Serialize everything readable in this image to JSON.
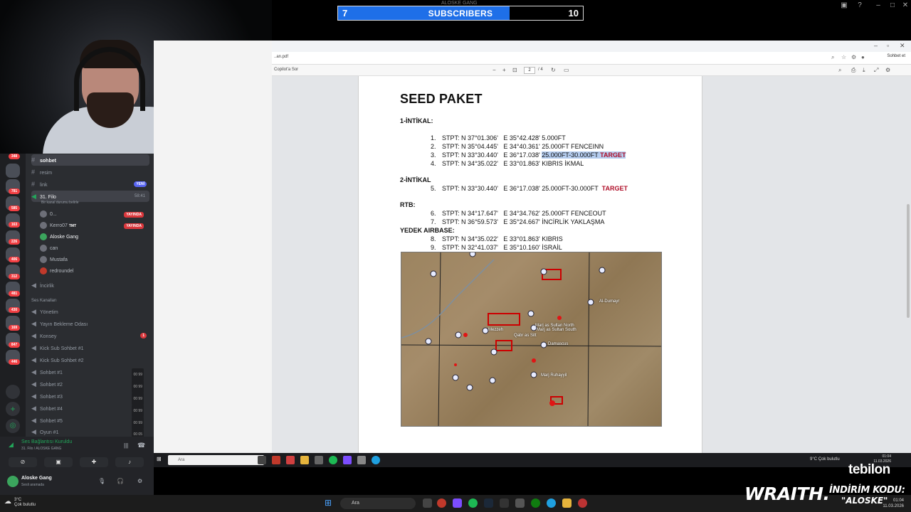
{
  "overlay": {
    "channel_label": "ALOSKE GANG",
    "subscribers": {
      "current": "7",
      "label": "SUBSCRIBERS",
      "goal": "10",
      "progress_fraction": 0.7
    }
  },
  "browser": {
    "url": "..an.pdf",
    "copilot_label": "Copilot'a Sor",
    "chat_label": "Sohbet et",
    "page_current": "2",
    "page_total": "/ 4"
  },
  "pdf": {
    "title": "SEED PAKET",
    "sections": [
      {
        "label": "1-İNTİKAL:",
        "items": [
          {
            "n": "1.",
            "text": "STPT: N 37°01.306'   E 35°42.428' 5.000FT",
            "hl": "",
            "target": ""
          },
          {
            "n": "2.",
            "text": "STPT: N 35°04.445'   E 34°40.361' 25.000FT FENCEINN",
            "hl": "",
            "target": ""
          },
          {
            "n": "3.",
            "text": "STPT: N 33°30.440'   E 36°17.038' ",
            "hl": "25.000FT-30.000FT",
            "target": "TARGET"
          },
          {
            "n": "4.",
            "text": "STPT: N 34°35.022'   E 33°01.863' KIBRIS İKMAL",
            "hl": "",
            "target": ""
          }
        ]
      },
      {
        "label": "2-İNTİKAL",
        "items": [
          {
            "n": "5.",
            "text": "STPT: N 33°30.440'   E 36°17.038' 25.000FT-30.000FT  ",
            "hl": "",
            "target": "TARGET"
          }
        ]
      },
      {
        "label": "RTB:",
        "items": [
          {
            "n": "6.",
            "text": "STPT: N 34°17.647'   E 34°34.762' 25.000FT FENCEOUT",
            "hl": "",
            "target": ""
          },
          {
            "n": "7.",
            "text": "STPT: N 36°59.573'   E 35°24.667' İNCİRLİK YAKLAŞMA",
            "hl": "",
            "target": ""
          }
        ]
      },
      {
        "label": "YEDEK AIRBASE:",
        "items": [
          {
            "n": "8.",
            "text": "STPT: N 34°35.022'   E 33°01.863' KIBRIS",
            "hl": "",
            "target": ""
          },
          {
            "n": "9.",
            "text": "STPT: N 32°41.037'   E 35°10.160' İSRAİL",
            "hl": "",
            "target": ""
          }
        ]
      }
    ],
    "map_labels": [
      "Al-Dumayr",
      "Marj as Sultan North",
      "Marj as Sultan South",
      "Qabr as Sitt",
      "Mezzeh",
      "Damascus",
      "Marj Ruhayyil"
    ]
  },
  "discord": {
    "server_badges": [
      "348",
      "781",
      "585",
      "163",
      "226",
      "406",
      "312",
      "481",
      "430",
      "169",
      "847",
      "446"
    ],
    "channels": [
      {
        "name": "sohbet",
        "badge": ""
      },
      {
        "name": "resim",
        "badge": ""
      },
      {
        "name": "link",
        "badge": "YENİ"
      }
    ],
    "voice_channel": {
      "name": "31. Filo",
      "timer": "58:41",
      "status": "Bir kanal durumu belirle"
    },
    "voice_users": [
      {
        "name": "0...",
        "live": "YAYINDA"
      },
      {
        "name": "Kerro07",
        "tag": "TMT",
        "live": "YAYINDA"
      },
      {
        "name": "Aloske Gang",
        "live": ""
      },
      {
        "name": "can",
        "live": ""
      },
      {
        "name": "Mustafa",
        "live": ""
      },
      {
        "name": "redroundel",
        "live": ""
      }
    ],
    "other_channel": "İncirlik",
    "category": "Ses Kanalları",
    "voice_channels": [
      {
        "name": "Yönetim",
        "stat": ""
      },
      {
        "name": "Yayın Bekleme Odası",
        "stat": ""
      },
      {
        "name": "Konsey",
        "stat": "1"
      },
      {
        "name": "Kick Sub Sohbet #1",
        "stat": ""
      },
      {
        "name": "Kick Sub Sohbet #2",
        "stat": ""
      },
      {
        "name": "Sohbet #1",
        "stat": "00 99"
      },
      {
        "name": "Sohbet #2",
        "stat": "00 99"
      },
      {
        "name": "Sohbet #3",
        "stat": "00 99"
      },
      {
        "name": "Sohbet #4",
        "stat": "00 99"
      },
      {
        "name": "Sohbet #5",
        "stat": "00 99"
      },
      {
        "name": "Oyun #1",
        "stat": "00 05"
      }
    ],
    "voice_status": "Ses Bağlantısı Kuruldu",
    "voice_sub": "31. Filo / ALOSKE GANG",
    "user": {
      "name": "Aloske Gang",
      "status": "Sesli aramada"
    }
  },
  "inner_taskbar": {
    "search": "Ara",
    "weather": "9°C  Çok bulutlu",
    "time": "01:04",
    "date": "11.03.2026"
  },
  "outer_taskbar": {
    "temp": "3°C",
    "weather": "Çok bulutlu",
    "search": "Ara",
    "time": "01:04",
    "date": "11.03.2026"
  },
  "sponsor": {
    "brand": "tebilon",
    "product": "WRAITH.",
    "promo_label": "İNDİRİM KODU:",
    "promo_code": "\"ALOSKE\""
  },
  "colors": {
    "sub_fill": "#1e6fe8",
    "target_red": "#b0102a",
    "highlight": "#b5cdef",
    "discord_bg": "#2b2d31"
  }
}
